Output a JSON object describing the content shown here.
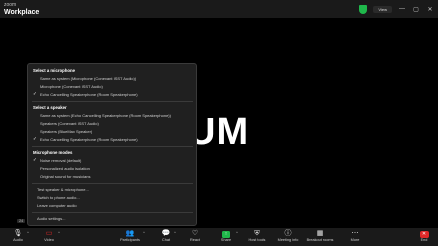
{
  "titlebar": {
    "brand_top": "zoom",
    "brand_bottom": "Workplace",
    "view_label": "View",
    "minimize": "—",
    "maximize": "▢",
    "close": "✕"
  },
  "participant": {
    "name": "UM"
  },
  "audio_menu": {
    "microphone_header": "Select a microphone",
    "microphones": [
      "Same as system (Microphone (Conexant ISST Audio))",
      "Microphone (Conexant ISST Audio)",
      "Echo Cancelling Speakerphone (Room Speakerphone)"
    ],
    "speaker_header": "Select a speaker",
    "speakers": [
      "Same as system (Echo Cancelling Speakerphone (Room Speakerphone))",
      "Speakers (Conexant ISST Audio)",
      "Speakers (BlueMax Speaker)",
      "Echo Cancelling Speakerphone (Room Speakerphone)"
    ],
    "modes_header": "Microphone modes",
    "modes": [
      "Noise removal (default)",
      "Personalized audio isolation",
      "Original sound for musicians"
    ],
    "actions": [
      "Test speaker & microphone...",
      "Switch to phone audio...",
      "Leave computer audio"
    ],
    "settings": "Audio settings..."
  },
  "small_tag": "24",
  "toolbar": {
    "audio": "Audio",
    "video": "Video",
    "participants": "Participants",
    "participants_count": "1",
    "chat": "Chat",
    "react": "React",
    "share": "Share",
    "host_tools": "Host tools",
    "meeting_info": "Meeting info",
    "breakout": "Breakout rooms",
    "more": "More",
    "end": "End"
  },
  "colors": {
    "share_green": "#1fb84b",
    "end_red": "#e02828",
    "security_green": "#1fb84b"
  }
}
